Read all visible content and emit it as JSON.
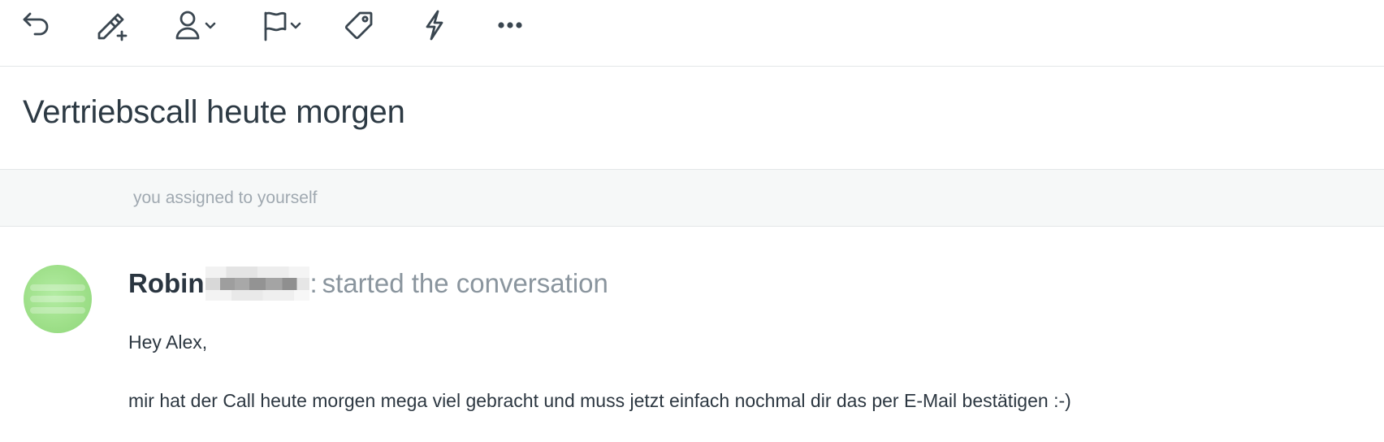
{
  "toolbar": {
    "buttons": [
      {
        "name": "reply-icon"
      },
      {
        "name": "edit-add-icon"
      },
      {
        "name": "assign-user-icon"
      },
      {
        "name": "flag-icon"
      },
      {
        "name": "tag-icon"
      },
      {
        "name": "lightning-icon"
      },
      {
        "name": "more-icon"
      }
    ]
  },
  "conversation": {
    "subject": "Vertriebscall heute morgen",
    "event": "you assigned to yourself"
  },
  "message": {
    "sender": "Robin",
    "colon": ":",
    "action": "started the conversation",
    "greeting": "Hey Alex,",
    "body": "mir hat der Call heute morgen mega viel gebracht und muss jetzt einfach nochmal dir das per E-Mail bestätigen :-)"
  },
  "colors": {
    "text": "#2d3a44",
    "muted": "#8a959e",
    "divider": "#e3e6e8",
    "avatar": "#9fe08a"
  }
}
